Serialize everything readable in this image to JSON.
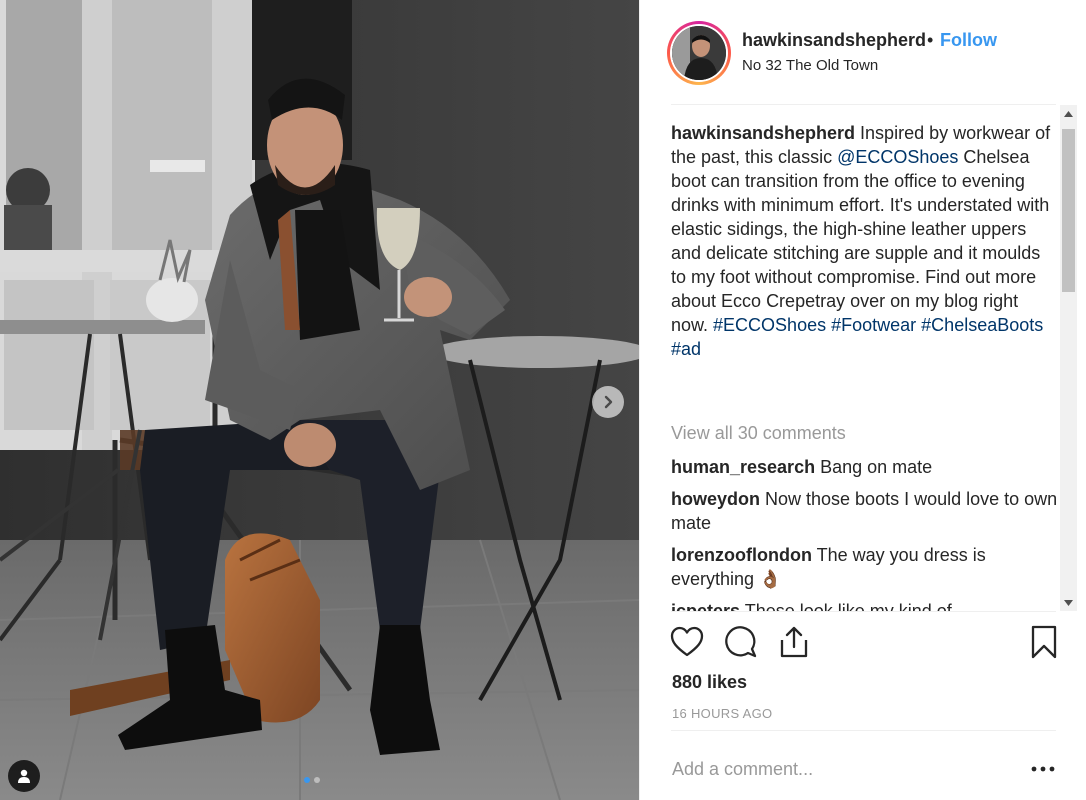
{
  "colors": {
    "accent": "#3897f0",
    "link": "#003569",
    "muted": "#999999",
    "text": "#262626"
  },
  "post": {
    "username": "hawkinsandshepherd",
    "separator": "•",
    "follow_label": "Follow",
    "location": "No 32 The Old Town",
    "caption": {
      "username": "hawkinsandshepherd",
      "text_1": " Inspired by workwear of the past, this classic ",
      "mention": "@ECCOShoes",
      "text_2": " Chelsea boot can transition from the office to evening drinks with minimum effort. It's understated with elastic sidings, the high-shine leather uppers and delicate stitching are supple and it moulds to my foot without compromise. Find out more about Ecco Crepetray over on my blog right now. ",
      "hashtags": [
        "#ECCOShoes",
        "#Footwear",
        "#ChelseaBoots",
        "#ad"
      ]
    },
    "view_all_label": "View all 30 comments",
    "comments": [
      {
        "username": "human_research",
        "text": " Bang on mate"
      },
      {
        "username": "howeydon",
        "text": " Now those boots I would love to own mate"
      },
      {
        "username": "lorenzooflondon",
        "text": " The way you dress is everything 👌🏾"
      },
      {
        "username": "icpeters",
        "text": " These look like my kind of"
      }
    ],
    "likes_label": "880 likes",
    "time_label": "16 HOURS AGO",
    "add_comment_placeholder": "Add a comment...",
    "more_label": "•••"
  },
  "media": {
    "carousel_count": 2,
    "carousel_active": 1
  },
  "icons": {
    "like": "heart-icon",
    "comment": "speech-bubble-icon",
    "share": "share-icon",
    "save": "bookmark-icon",
    "next": "chevron-right-icon",
    "tags": "user-tag-icon"
  }
}
